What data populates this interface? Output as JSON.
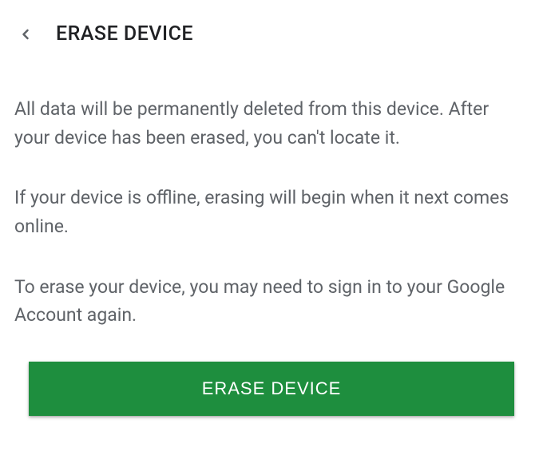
{
  "header": {
    "title": "ERASE DEVICE"
  },
  "content": {
    "paragraph1": "All data will be permanently deleted from this device. After your device has been erased, you can't locate it.",
    "paragraph2": "If your device is offline, erasing will begin when it next comes online.",
    "paragraph3": "To erase your device, you may need to sign in to your Google Account again."
  },
  "actions": {
    "erase_button_label": "ERASE DEVICE"
  },
  "colors": {
    "primary_green": "#1e8e3e",
    "text_primary": "#202124",
    "text_secondary": "#5f6368"
  }
}
